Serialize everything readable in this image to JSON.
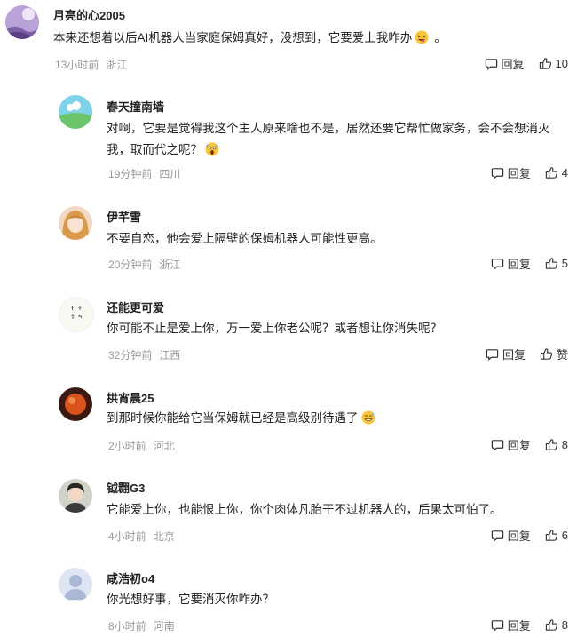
{
  "reply_label": "回复",
  "comments": [
    {
      "author": "月亮的心2005",
      "text": "本来还想着以后AI机器人当家庭保姆真好，没想到，它要爱上我咋办",
      "emoji": "laughing-tongue-emoji",
      "time": "13小时前",
      "location": "浙江",
      "likes": "10"
    },
    {
      "author": "春天撞南墙",
      "text": "对啊，它要是觉得我这个主人原来啥也不是，居然还要它帮忙做家务，会不会想消灭我，取而代之呢？",
      "emoji": "screaming-face-emoji",
      "time": "19分钟前",
      "location": "四川",
      "likes": "4"
    },
    {
      "author": "伊芊雪",
      "text": "不要自恋，他会爱上隔壁的保姆机器人可能性更高。",
      "time": "20分钟前",
      "location": "浙江",
      "likes": "5"
    },
    {
      "author": "还能更可爱",
      "text": "你可能不止是爱上你，万一爱上你老公呢？或者想让你消失呢？",
      "time": "32分钟前",
      "location": "江西",
      "likes": "赞"
    },
    {
      "author": "拱宵晨25",
      "text": "到那时候你能给它当保姆就已经是高级别待遇了",
      "emoji": "grinning-sweat-emoji",
      "time": "2小时前",
      "location": "河北",
      "likes": "8"
    },
    {
      "author": "钺翾G3",
      "text": "它能爱上你，也能恨上你，你个肉体凡胎干不过机器人的，后果太可怕了。",
      "time": "4小时前",
      "location": "北京",
      "likes": "6"
    },
    {
      "author": "咸浩初o4",
      "text": "你光想好事，它要消灭你咋办？",
      "time": "8小时前",
      "location": "河南",
      "likes": "8"
    }
  ]
}
